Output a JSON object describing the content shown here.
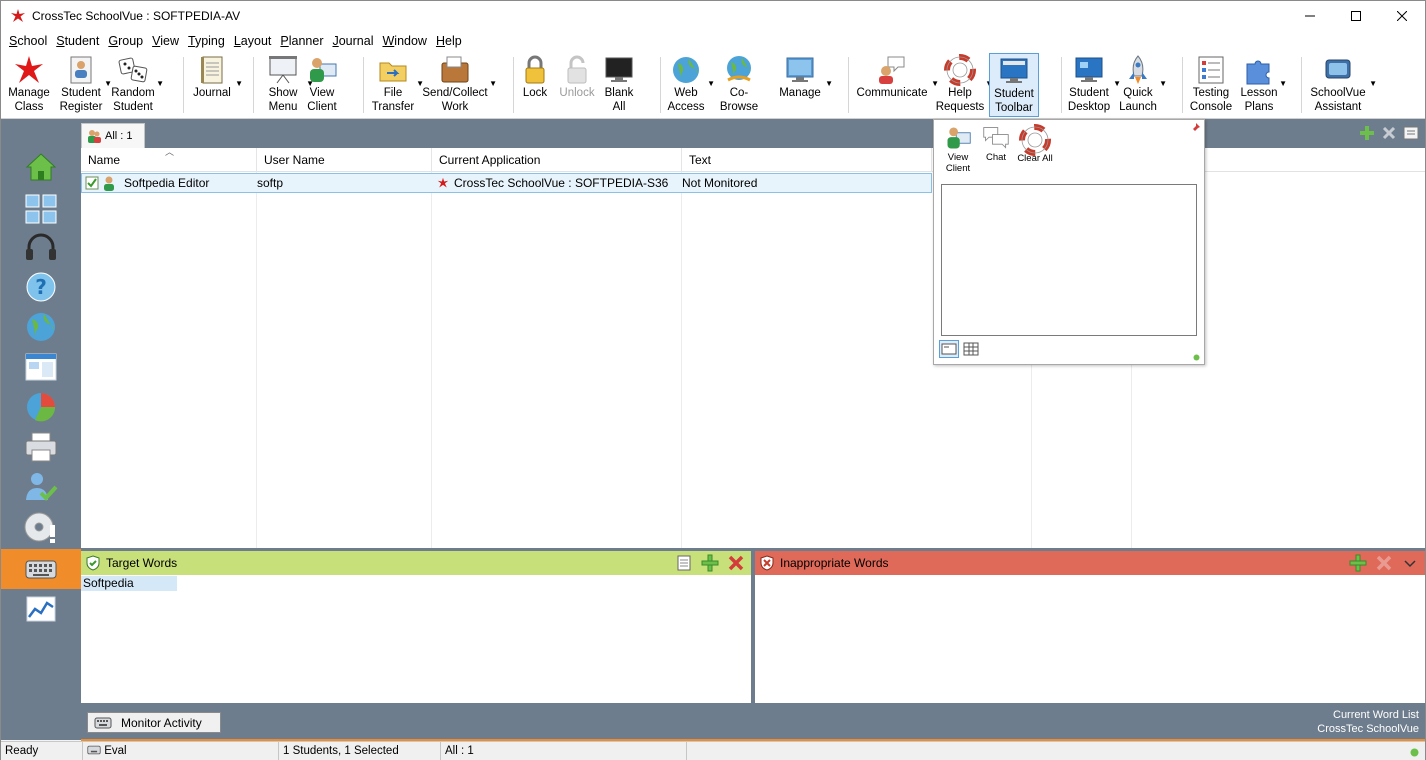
{
  "window": {
    "title": "CrossTec SchoolVue : SOFTPEDIA-AV"
  },
  "menu": {
    "items": [
      {
        "label": "School",
        "key": "S",
        "rest": "chool"
      },
      {
        "label": "Student",
        "key": "S",
        "rest": "tudent"
      },
      {
        "label": "Group",
        "key": "G",
        "rest": "roup"
      },
      {
        "label": "View",
        "key": "V",
        "rest": "iew"
      },
      {
        "label": "Typing",
        "key": "T",
        "rest": "yping"
      },
      {
        "label": "Layout",
        "key": "L",
        "rest": "ayout"
      },
      {
        "label": "Planner",
        "key": "P",
        "rest": "lanner"
      },
      {
        "label": "Journal",
        "key": "J",
        "rest": "ournal"
      },
      {
        "label": "Window",
        "key": "W",
        "rest": "indow"
      },
      {
        "label": "Help",
        "key": "H",
        "rest": "elp"
      }
    ]
  },
  "toolbar": {
    "manage_class": "Manage\nClass",
    "student_register": "Student\nRegister",
    "random_student": "Random\nStudent",
    "journal": "Journal",
    "show_menu": "Show\nMenu",
    "view_client": "View\nClient",
    "file_transfer": "File\nTransfer",
    "send_collect": "Send/Collect\nWork",
    "lock": "Lock",
    "unlock": "Unlock",
    "blank_all": "Blank\nAll",
    "web_access": "Web\nAccess",
    "co_browse": "Co-Browse",
    "manage": "Manage",
    "communicate": "Communicate",
    "help_requests": "Help\nRequests",
    "student_toolbar": "Student\nToolbar",
    "student_desktop": "Student\nDesktop",
    "quick_launch": "Quick\nLaunch",
    "testing_console": "Testing\nConsole",
    "lesson_plans": "Lesson\nPlans",
    "schoolvue_assistant": "SchoolVue\nAssistant"
  },
  "tab": {
    "label": "All : 1"
  },
  "grid": {
    "columns": [
      "Name",
      "User Name",
      "Current Application",
      "Text"
    ],
    "rows": [
      {
        "name": "Softpedia Editor",
        "user": "softp",
        "app": "CrossTec SchoolVue : SOFTPEDIA-S36",
        "text": "Not Monitored"
      }
    ]
  },
  "float_panel": {
    "view_client": "View\nClient",
    "chat": "Chat",
    "clear_all": "Clear All"
  },
  "target_words": {
    "title": "Target Words",
    "words": [
      "Softpedia"
    ]
  },
  "inappropriate_words": {
    "title": "Inappropriate Words"
  },
  "bottom": {
    "monitor_button": "Monitor Activity",
    "current_word_list": "Current Word List",
    "list_name": "CrossTec SchoolVue"
  },
  "status": {
    "ready": "Ready",
    "eval": "Eval",
    "students": "1 Students, 1 Selected",
    "all": "All : 1"
  },
  "colors": {
    "sidebar": "#6e7d8d",
    "accent_orange": "#f08c2a",
    "target_header": "#c8e07a",
    "inappropriate_header": "#e06a5a",
    "selection": "#e8f4fb"
  }
}
